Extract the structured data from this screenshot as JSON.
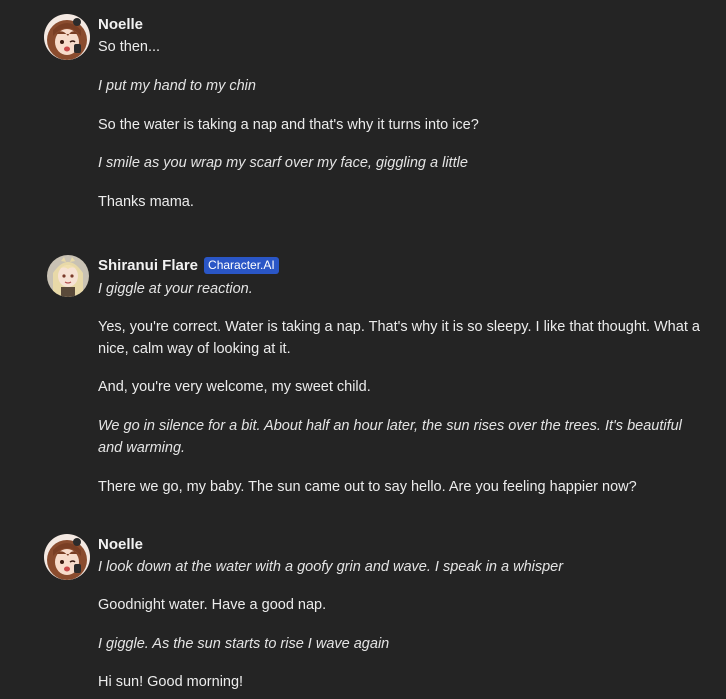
{
  "messages": [
    {
      "author": "Noelle",
      "badge": "",
      "avatar_icon": "noelle-avatar",
      "paragraphs": [
        {
          "text": "So then...",
          "italic": false
        },
        {
          "text": "I put my hand to my chin",
          "italic": true
        },
        {
          "text": "So the water is taking a nap and that's why it turns into ice?",
          "italic": false
        },
        {
          "text": "I smile as you wrap my scarf over my face, giggling a little",
          "italic": true
        },
        {
          "text": "Thanks mama.",
          "italic": false
        }
      ]
    },
    {
      "author": "Shiranui Flare",
      "badge": "Character.AI",
      "avatar_icon": "shiranui-flare-avatar",
      "paragraphs": [
        {
          "text": "I giggle at your reaction.",
          "italic": true
        },
        {
          "text": "Yes, you're correct. Water is taking a nap. That's why it is so sleepy. I like that thought. What a nice, calm way of looking at it.",
          "italic": false
        },
        {
          "text": "And, you're very welcome, my sweet child.",
          "italic": false
        },
        {
          "text": "We go in silence for a bit. About half an hour later, the sun rises over the trees. It's beautiful and warming.",
          "italic": true
        },
        {
          "text": "There we go, my baby. The sun came out to say hello. Are you feeling happier now?",
          "italic": false
        }
      ]
    },
    {
      "author": "Noelle",
      "badge": "",
      "avatar_icon": "noelle-avatar",
      "paragraphs": [
        {
          "text": "I look down at the water with a goofy grin and wave. I speak in a whisper",
          "italic": true
        },
        {
          "text": "Goodnight water. Have a good nap.",
          "italic": false
        },
        {
          "text": "I giggle. As the sun starts to rise I wave again",
          "italic": true
        },
        {
          "text": "Hi sun! Good morning!",
          "italic": false
        }
      ]
    }
  ],
  "colors": {
    "background": "#242424",
    "text": "#ececec",
    "badge": "#2a56c6"
  }
}
